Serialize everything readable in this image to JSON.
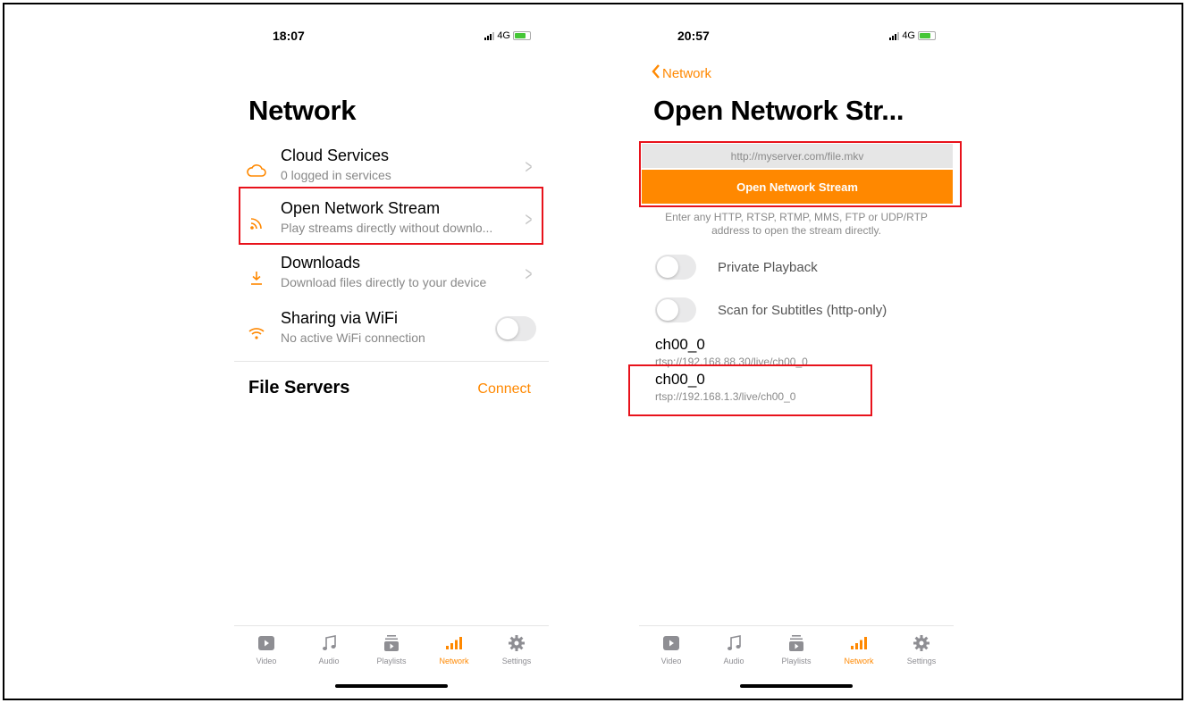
{
  "left": {
    "status_time": "18:07",
    "signal_label": "4G",
    "page_title": "Network",
    "rows": [
      {
        "title": "Cloud Services",
        "subtitle": "0 logged in services"
      },
      {
        "title": "Open Network Stream",
        "subtitle": "Play streams directly without downlo..."
      },
      {
        "title": "Downloads",
        "subtitle": "Download files directly to your device"
      },
      {
        "title": "Sharing via WiFi",
        "subtitle": "No active WiFi connection"
      }
    ],
    "section_title": "File Servers",
    "connect_label": "Connect"
  },
  "right": {
    "status_time": "20:57",
    "signal_label": "4G",
    "back_label": "Network",
    "page_title": "Open Network Str...",
    "url_placeholder": "http://myserver.com/file.mkv",
    "open_button": "Open Network Stream",
    "hint_text": "Enter any HTTP, RTSP, RTMP, MMS, FTP or UDP/RTP address to open the stream directly.",
    "toggles": [
      {
        "label": "Private Playback"
      },
      {
        "label": "Scan for Subtitles (http-only)"
      }
    ],
    "history": [
      {
        "name": "ch00_0",
        "url": "rtsp://192.168.88.30/live/ch00_0"
      },
      {
        "name": "ch00_0",
        "url": "rtsp://192.168.1.3/live/ch00_0"
      }
    ]
  },
  "tabs": [
    "Video",
    "Audio",
    "Playlists",
    "Network",
    "Settings"
  ],
  "active_tab": "Network",
  "colors": {
    "accent": "#ff8800",
    "highlight": "#e8121b",
    "secondary_text": "#888888"
  }
}
